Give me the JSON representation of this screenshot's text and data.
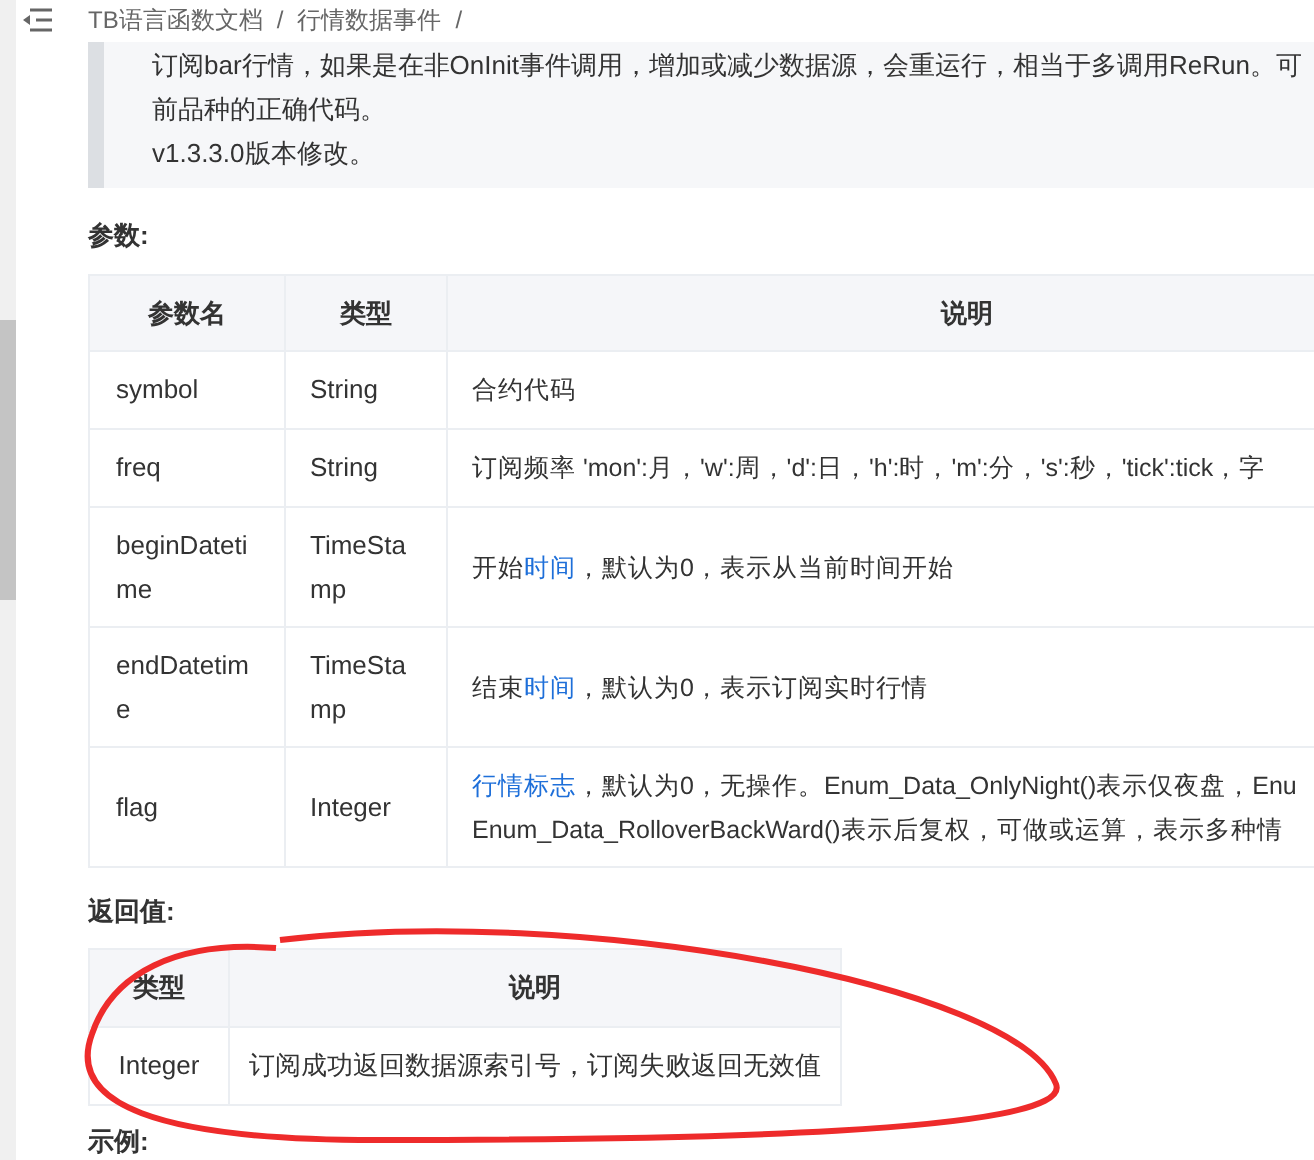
{
  "breadcrumb": [
    "TB语言函数文档",
    "/",
    "行情数据事件",
    "/"
  ],
  "note_lines": [
    "订阅bar行情，如果是在非OnInit事件调用，增加或减少数据源，会重运行，相当于多调用ReRun。可",
    "前品种的正确代码。",
    "v1.3.3.0版本修改。"
  ],
  "params": {
    "title": "参数:",
    "columns": [
      "参数名",
      "类型",
      "说明"
    ],
    "rows": [
      {
        "name": "symbol",
        "type": "String",
        "description": [
          [
            {
              "text": "合约代码",
              "link": false
            }
          ]
        ]
      },
      {
        "name": "freq",
        "type": "String",
        "description": [
          [
            {
              "text": "订阅频率 'mon':月，'w':周，'d':日，'h':时，'m':分，'s':秒，'tick':tick，字",
              "link": false
            }
          ]
        ]
      },
      {
        "name": "beginDatetime",
        "type": "TimeStamp",
        "description": [
          [
            {
              "text": "开始",
              "link": false
            },
            {
              "text": "时间",
              "link": true
            },
            {
              "text": "，默认为0，表示从当前时间开始",
              "link": false
            }
          ]
        ]
      },
      {
        "name": "endDatetime",
        "type": "TimeStamp",
        "description": [
          [
            {
              "text": "结束",
              "link": false
            },
            {
              "text": "时间",
              "link": true
            },
            {
              "text": "，默认为0，表示订阅实时行情",
              "link": false
            }
          ]
        ]
      },
      {
        "name": "flag",
        "type": "Integer",
        "description": [
          [
            {
              "text": "行情标志",
              "link": true
            },
            {
              "text": "，默认为0，无操作。Enum_Data_OnlyNight()表示仅夜盘，Enu",
              "link": false
            }
          ],
          [
            {
              "text": "Enum_Data_RolloverBackWard()表示后复权，可做或运算，表示多种情",
              "link": false
            }
          ]
        ]
      }
    ]
  },
  "returns": {
    "title": "返回值:",
    "columns": [
      "类型",
      "说明"
    ],
    "rows": [
      {
        "type": "Integer",
        "description": "订阅成功返回数据源索引号，订阅失败返回无效值"
      }
    ]
  },
  "example": {
    "title": "示例:"
  }
}
